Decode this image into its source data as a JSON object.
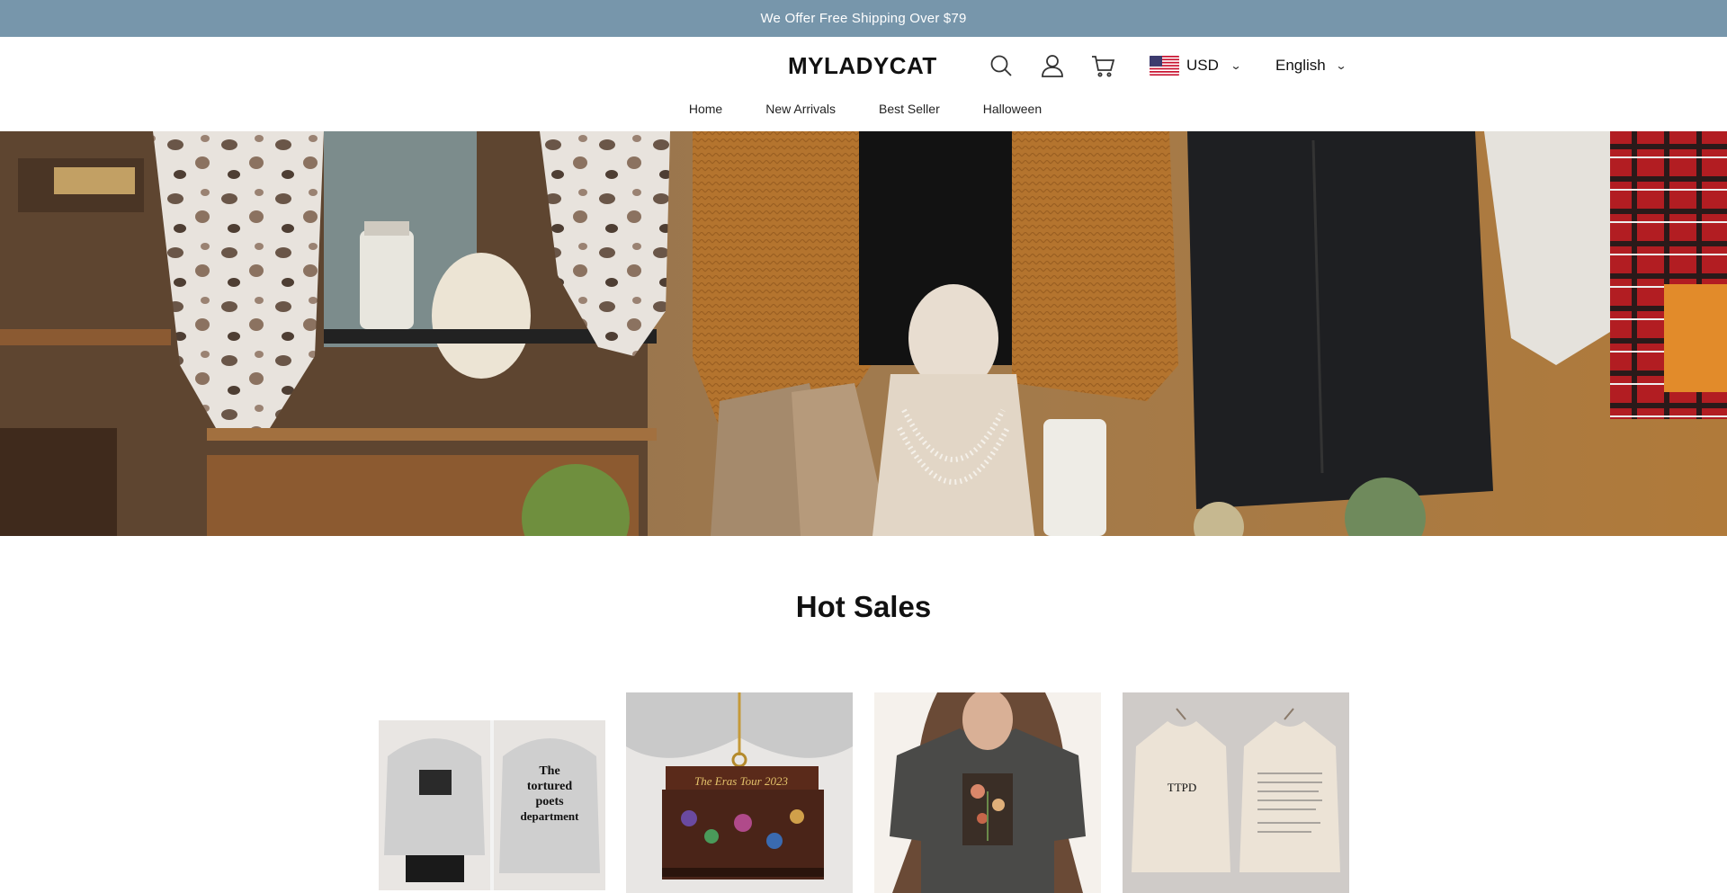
{
  "announcement": {
    "text": "We Offer Free Shipping Over $79"
  },
  "header": {
    "logo": "MYLADYCAT",
    "icons": [
      "search-icon",
      "account-icon",
      "cart-icon"
    ],
    "currency": {
      "code": "USD",
      "flag": "us-flag-icon"
    },
    "language": "English"
  },
  "nav": {
    "items": [
      {
        "label": "Home"
      },
      {
        "label": "New Arrivals"
      },
      {
        "label": "Best Seller"
      },
      {
        "label": "Halloween"
      }
    ]
  },
  "hero": {
    "alt": "Boutique display with sweaters, boots, pearl necklace, candles and pumpkins"
  },
  "hot_sales": {
    "title": "Hot Sales",
    "products": [
      {
        "image": "grey sweatshirt front and back"
      },
      {
        "image": "The Eras Tour 2023 piano ornament"
      },
      {
        "image": "charcoal floral graphic t-shirt"
      },
      {
        "image": "beige sweatshirts front and back"
      }
    ]
  },
  "colors": {
    "announcement_bg": "#7796ab",
    "text": "#111111"
  }
}
